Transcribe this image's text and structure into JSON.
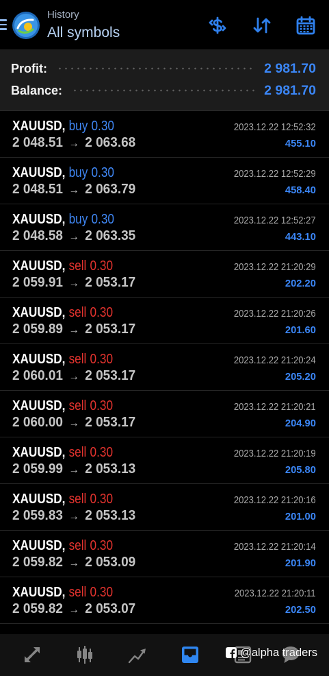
{
  "header": {
    "title": "History",
    "subtitle": "All symbols",
    "menu_icon": "menu-icon",
    "logo": "metatrader-logo",
    "actions": [
      "deposit-withdrawal-icon",
      "sort-icon",
      "calendar-icon"
    ]
  },
  "summary": {
    "profit_label": "Profit:",
    "profit": "2 981.70",
    "balance_label": "Balance:",
    "balance": "2 981.70"
  },
  "deals": [
    {
      "symbol": "XAUUSD",
      "type": "buy",
      "volume": "0.30",
      "open_price": "2 048.51",
      "close_price": "2 063.68",
      "time": "2023.12.22 12:52:32",
      "profit": "455.10"
    },
    {
      "symbol": "XAUUSD",
      "type": "buy",
      "volume": "0.30",
      "open_price": "2 048.51",
      "close_price": "2 063.79",
      "time": "2023.12.22 12:52:29",
      "profit": "458.40"
    },
    {
      "symbol": "XAUUSD",
      "type": "buy",
      "volume": "0.30",
      "open_price": "2 048.58",
      "close_price": "2 063.35",
      "time": "2023.12.22 12:52:27",
      "profit": "443.10"
    },
    {
      "symbol": "XAUUSD",
      "type": "sell",
      "volume": "0.30",
      "open_price": "2 059.91",
      "close_price": "2 053.17",
      "time": "2023.12.22 21:20:29",
      "profit": "202.20"
    },
    {
      "symbol": "XAUUSD",
      "type": "sell",
      "volume": "0.30",
      "open_price": "2 059.89",
      "close_price": "2 053.17",
      "time": "2023.12.22 21:20:26",
      "profit": "201.60"
    },
    {
      "symbol": "XAUUSD",
      "type": "sell",
      "volume": "0.30",
      "open_price": "2 060.01",
      "close_price": "2 053.17",
      "time": "2023.12.22 21:20:24",
      "profit": "205.20"
    },
    {
      "symbol": "XAUUSD",
      "type": "sell",
      "volume": "0.30",
      "open_price": "2 060.00",
      "close_price": "2 053.17",
      "time": "2023.12.22 21:20:21",
      "profit": "204.90"
    },
    {
      "symbol": "XAUUSD",
      "type": "sell",
      "volume": "0.30",
      "open_price": "2 059.99",
      "close_price": "2 053.13",
      "time": "2023.12.22 21:20:19",
      "profit": "205.80"
    },
    {
      "symbol": "XAUUSD",
      "type": "sell",
      "volume": "0.30",
      "open_price": "2 059.83",
      "close_price": "2 053.13",
      "time": "2023.12.22 21:20:16",
      "profit": "201.00"
    },
    {
      "symbol": "XAUUSD",
      "type": "sell",
      "volume": "0.30",
      "open_price": "2 059.82",
      "close_price": "2 053.09",
      "time": "2023.12.22 21:20:14",
      "profit": "201.90"
    },
    {
      "symbol": "XAUUSD",
      "type": "sell",
      "volume": "0.30",
      "open_price": "2 059.82",
      "close_price": "2 053.07",
      "time": "2023.12.22 21:20:11",
      "profit": "202.50"
    }
  ],
  "bottom_nav": {
    "tabs": [
      {
        "icon": "quotes-icon",
        "active": false
      },
      {
        "icon": "chart-icon",
        "active": false
      },
      {
        "icon": "trade-icon",
        "active": false
      },
      {
        "icon": "history-icon",
        "active": true
      },
      {
        "icon": "news-icon",
        "active": false
      },
      {
        "icon": "messages-icon",
        "active": false
      }
    ]
  },
  "watermark": {
    "icon": "facebook-icon",
    "text": "@alpha traders"
  },
  "colors": {
    "background": "#000000",
    "panel": "#1c1c1c",
    "accent_blue": "#3b86f6",
    "sell_red": "#e3332e",
    "price_gray": "#c4c4c4"
  }
}
